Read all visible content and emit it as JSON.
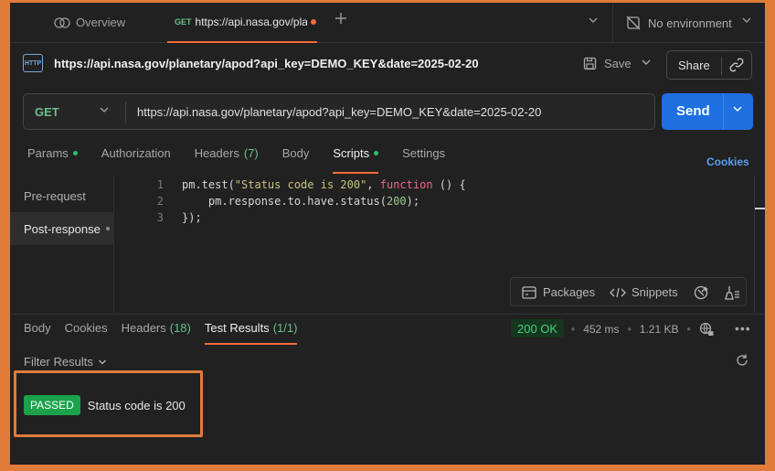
{
  "tabs": {
    "overview_label": "Overview",
    "active_method": "GET",
    "active_title": "https://api.nasa.gov/pla"
  },
  "environment": {
    "label": "No environment"
  },
  "request_title": {
    "url": "https://api.nasa.gov/planetary/apod?api_key=DEMO_KEY&date=2025-02-20",
    "save_label": "Save",
    "share_label": "Share"
  },
  "request_bar": {
    "method": "GET",
    "url": "https://api.nasa.gov/planetary/apod?api_key=DEMO_KEY&date=2025-02-20",
    "send_label": "Send"
  },
  "request_tabs": [
    {
      "label": "Params",
      "dot": true
    },
    {
      "label": "Authorization"
    },
    {
      "label": "Headers",
      "count": "(7)"
    },
    {
      "label": "Body"
    },
    {
      "label": "Scripts",
      "dot": true,
      "active": true
    },
    {
      "label": "Settings"
    }
  ],
  "cookies_label": "Cookies",
  "script_sidebar": [
    {
      "label": "Pre-request"
    },
    {
      "label": "Post-response",
      "active": true
    }
  ],
  "code": {
    "line_numbers": [
      "1",
      "2",
      "3"
    ],
    "line1": {
      "fn": "pm.test(",
      "str": "\"Status code is 200\"",
      "sep": ", ",
      "kw": "function",
      "rest": " () {"
    },
    "line2": {
      "indent": "    ",
      "fn": "pm.response.to.have.status(",
      "num": "200",
      "rest": ");"
    },
    "line3": {
      "text": "});"
    }
  },
  "script_toolbar": {
    "packages_label": "Packages",
    "snippets_label": "Snippets"
  },
  "response_tabs": [
    {
      "label": "Body"
    },
    {
      "label": "Cookies"
    },
    {
      "label": "Headers",
      "count": "(18)"
    },
    {
      "label": "Test Results",
      "count": "(1/1)",
      "active": true
    }
  ],
  "response_meta": {
    "status": "200 OK",
    "time": "452 ms",
    "size": "1.21 KB"
  },
  "filter_label": "Filter Results",
  "test_result": {
    "badge": "PASSED",
    "name": "Status code is 200"
  },
  "colors": {
    "accent": "#f26b3a",
    "send": "#1f6fe0",
    "pass": "#1ba24b",
    "frame": "#e07b39"
  }
}
